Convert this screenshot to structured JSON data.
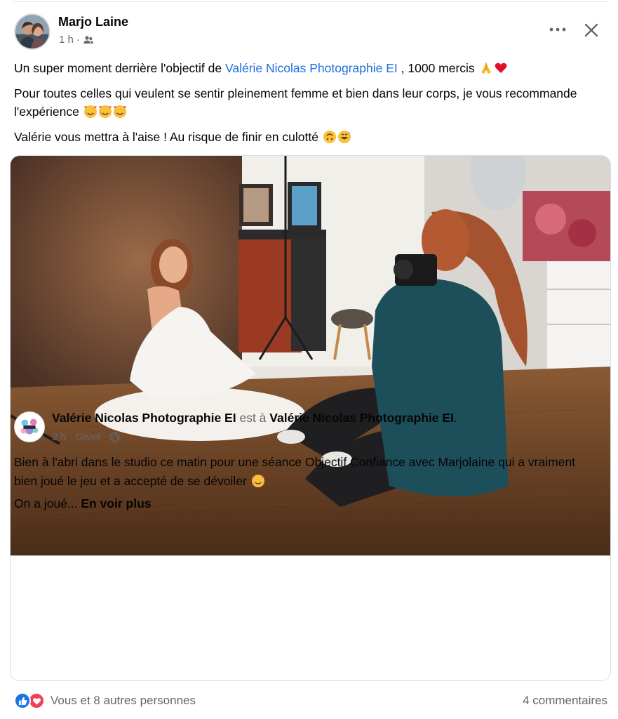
{
  "post": {
    "author": "Marjo Laine",
    "time": "1 h",
    "separator": "·",
    "audience_icon": "friends-icon",
    "line1_pre": "Un super moment derrière l'objectif de ",
    "line1_link": "Valérie Nicolas Photographie EI",
    "line1_post": " , 1000 mercis",
    "line1_emojis": [
      "folded-hands-emoji",
      "red-heart-emoji"
    ],
    "line2": "Pour toutes celles qui veulent se sentir pleinement femme et bien dans leur corps, je vous recommande l'expérience",
    "line2_emojis": [
      "smiling-face-with-hearts-emoji",
      "smiling-face-with-hearts-emoji",
      "smiling-face-with-hearts-emoji"
    ],
    "line3": "Valérie vous mettra à l'aise ! Au risque de finir en culotté",
    "line3_emojis": [
      "upside-down-face-emoji",
      "grinning-sweat-emoji"
    ]
  },
  "shared": {
    "page_name": "Valérie Nicolas Photographie EI",
    "connector": "est à",
    "location_page": "Valérie Nicolas Photographie EI",
    "period": ".",
    "time": "2 h",
    "place": "Givet",
    "separator": "·",
    "audience_icon": "globe-icon",
    "text": "Bien à l'abri dans le studio ce matin pour une séance Objectif Confiance avec Marjolaine qui a vraiment bien joué le jeu et a accepté de se dévoiler",
    "text_emoji": "smiling-face-with-hearts-emoji",
    "more_prefix": "On a joué... ",
    "see_more": "En voir plus"
  },
  "footer": {
    "reactors": "Vous et 8 autres personnes",
    "comments": "4 commentaires",
    "reaction_icons": [
      "like-icon",
      "love-icon"
    ]
  },
  "colors": {
    "link": "#216fdb",
    "muted": "#65676b",
    "like": "#1b74e4",
    "love": "#f33e58"
  }
}
